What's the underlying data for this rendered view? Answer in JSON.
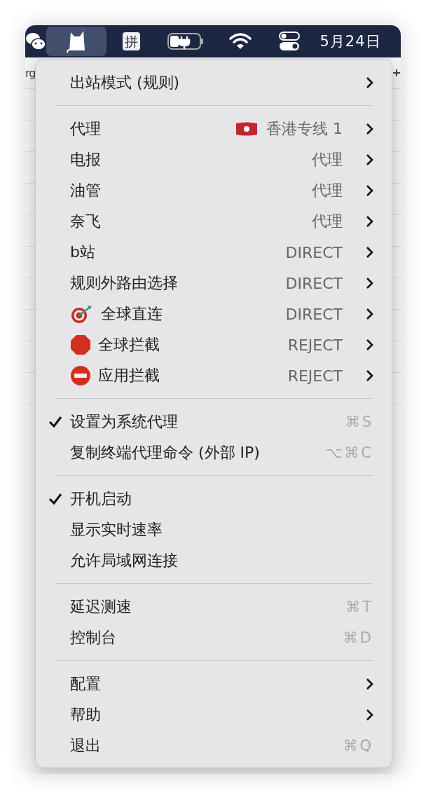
{
  "menu_bar": {
    "items": [
      {
        "kind": "wechat",
        "selected": false
      },
      {
        "kind": "cat",
        "selected": true
      },
      {
        "kind": "input",
        "label": "拼",
        "selected": false
      },
      {
        "kind": "battery",
        "selected": false
      },
      {
        "kind": "wifi",
        "selected": false
      },
      {
        "kind": "control",
        "selected": false
      },
      {
        "kind": "clock",
        "label": "5月24日",
        "selected": false
      }
    ]
  },
  "background_window": {
    "fragment": "rg"
  },
  "menu": {
    "sections": [
      [
        {
          "label": "出站模式 (规则)",
          "submenu": true
        }
      ],
      [
        {
          "label": "代理",
          "value": "香港专线 1",
          "kind": "flagged",
          "submenu": true
        },
        {
          "label": "电报",
          "value": "代理",
          "kind": "plain",
          "submenu": true
        },
        {
          "label": "油管",
          "value": "代理",
          "kind": "plain",
          "submenu": true
        },
        {
          "label": "奈飞",
          "value": "代理",
          "kind": "plain",
          "submenu": true
        },
        {
          "label": "b站",
          "value": "DIRECT",
          "kind": "plain",
          "submenu": true
        },
        {
          "label": "规则外路由选择",
          "value": "DIRECT",
          "kind": "plain",
          "submenu": true
        },
        {
          "label": "全球直连",
          "kind": "target",
          "value": "DIRECT",
          "submenu": true
        },
        {
          "label": "全球拦截",
          "kind": "stop",
          "value": "REJECT",
          "submenu": true
        },
        {
          "label": "应用拦截",
          "kind": "no-entry",
          "value": "REJECT",
          "submenu": true
        }
      ],
      [
        {
          "label": "设置为系统代理",
          "shortcut": "⌘S",
          "checked": true
        },
        {
          "label": "复制终端代理命令 (外部 IP)",
          "shortcut": "⌥⌘C",
          "checked": false
        }
      ],
      [
        {
          "label": "开机启动",
          "checked": true
        },
        {
          "label": "显示实时速率",
          "checked": false
        },
        {
          "label": "允许局域网连接",
          "checked": false
        }
      ],
      [
        {
          "label": "延迟测速",
          "shortcut": "⌘T"
        },
        {
          "label": "控制台",
          "shortcut": "⌘D"
        }
      ],
      [
        {
          "label": "配置",
          "submenu": true
        },
        {
          "label": "帮助",
          "submenu": true
        },
        {
          "label": "退出",
          "shortcut": "⌘Q"
        }
      ]
    ]
  }
}
